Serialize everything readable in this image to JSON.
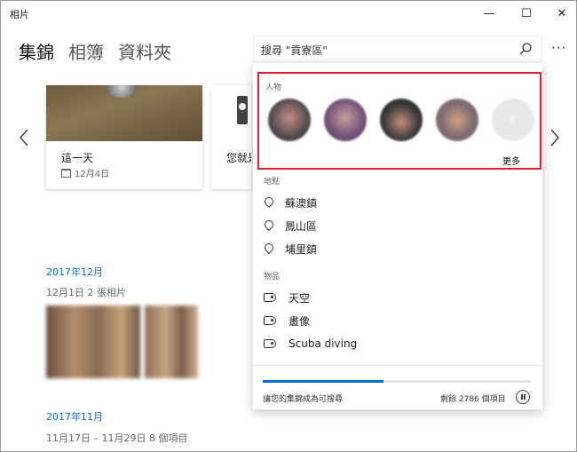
{
  "window": {
    "title": "相片",
    "minimize": "—",
    "maximize": "☐",
    "close": "✕"
  },
  "nav": {
    "tabs": [
      "集錦",
      "相簿",
      "資料夾"
    ],
    "active": 0
  },
  "search": {
    "value": "搜尋 \"貢寮區\"",
    "placeholder": "搜尋"
  },
  "header": {
    "more": "···"
  },
  "cards": [
    {
      "title": "這一天",
      "meta": "12月4日"
    },
    {
      "title": "您就是"
    }
  ],
  "groups": [
    {
      "month": "2017年12月",
      "line": "12月1日   2 張相片"
    },
    {
      "month": "2017年11月",
      "line": "11月17日 – 11月29日   8 個項目"
    }
  ],
  "dropdown": {
    "people": {
      "label": "人物",
      "more": "更多"
    },
    "places": {
      "label": "地點",
      "items": [
        "蘇澳鎮",
        "鳳山區",
        "埔里鎮"
      ]
    },
    "things": {
      "label": "物品",
      "items": [
        "天空",
        "畫像",
        "Scuba diving"
      ]
    },
    "indexing": {
      "text": "讓您的集錦成為可搜尋",
      "remaining": "剩餘 2786 個項目",
      "progress": 0.45
    }
  },
  "colors": {
    "accent": "#0a6ed1",
    "highlight": "#d9202f"
  }
}
